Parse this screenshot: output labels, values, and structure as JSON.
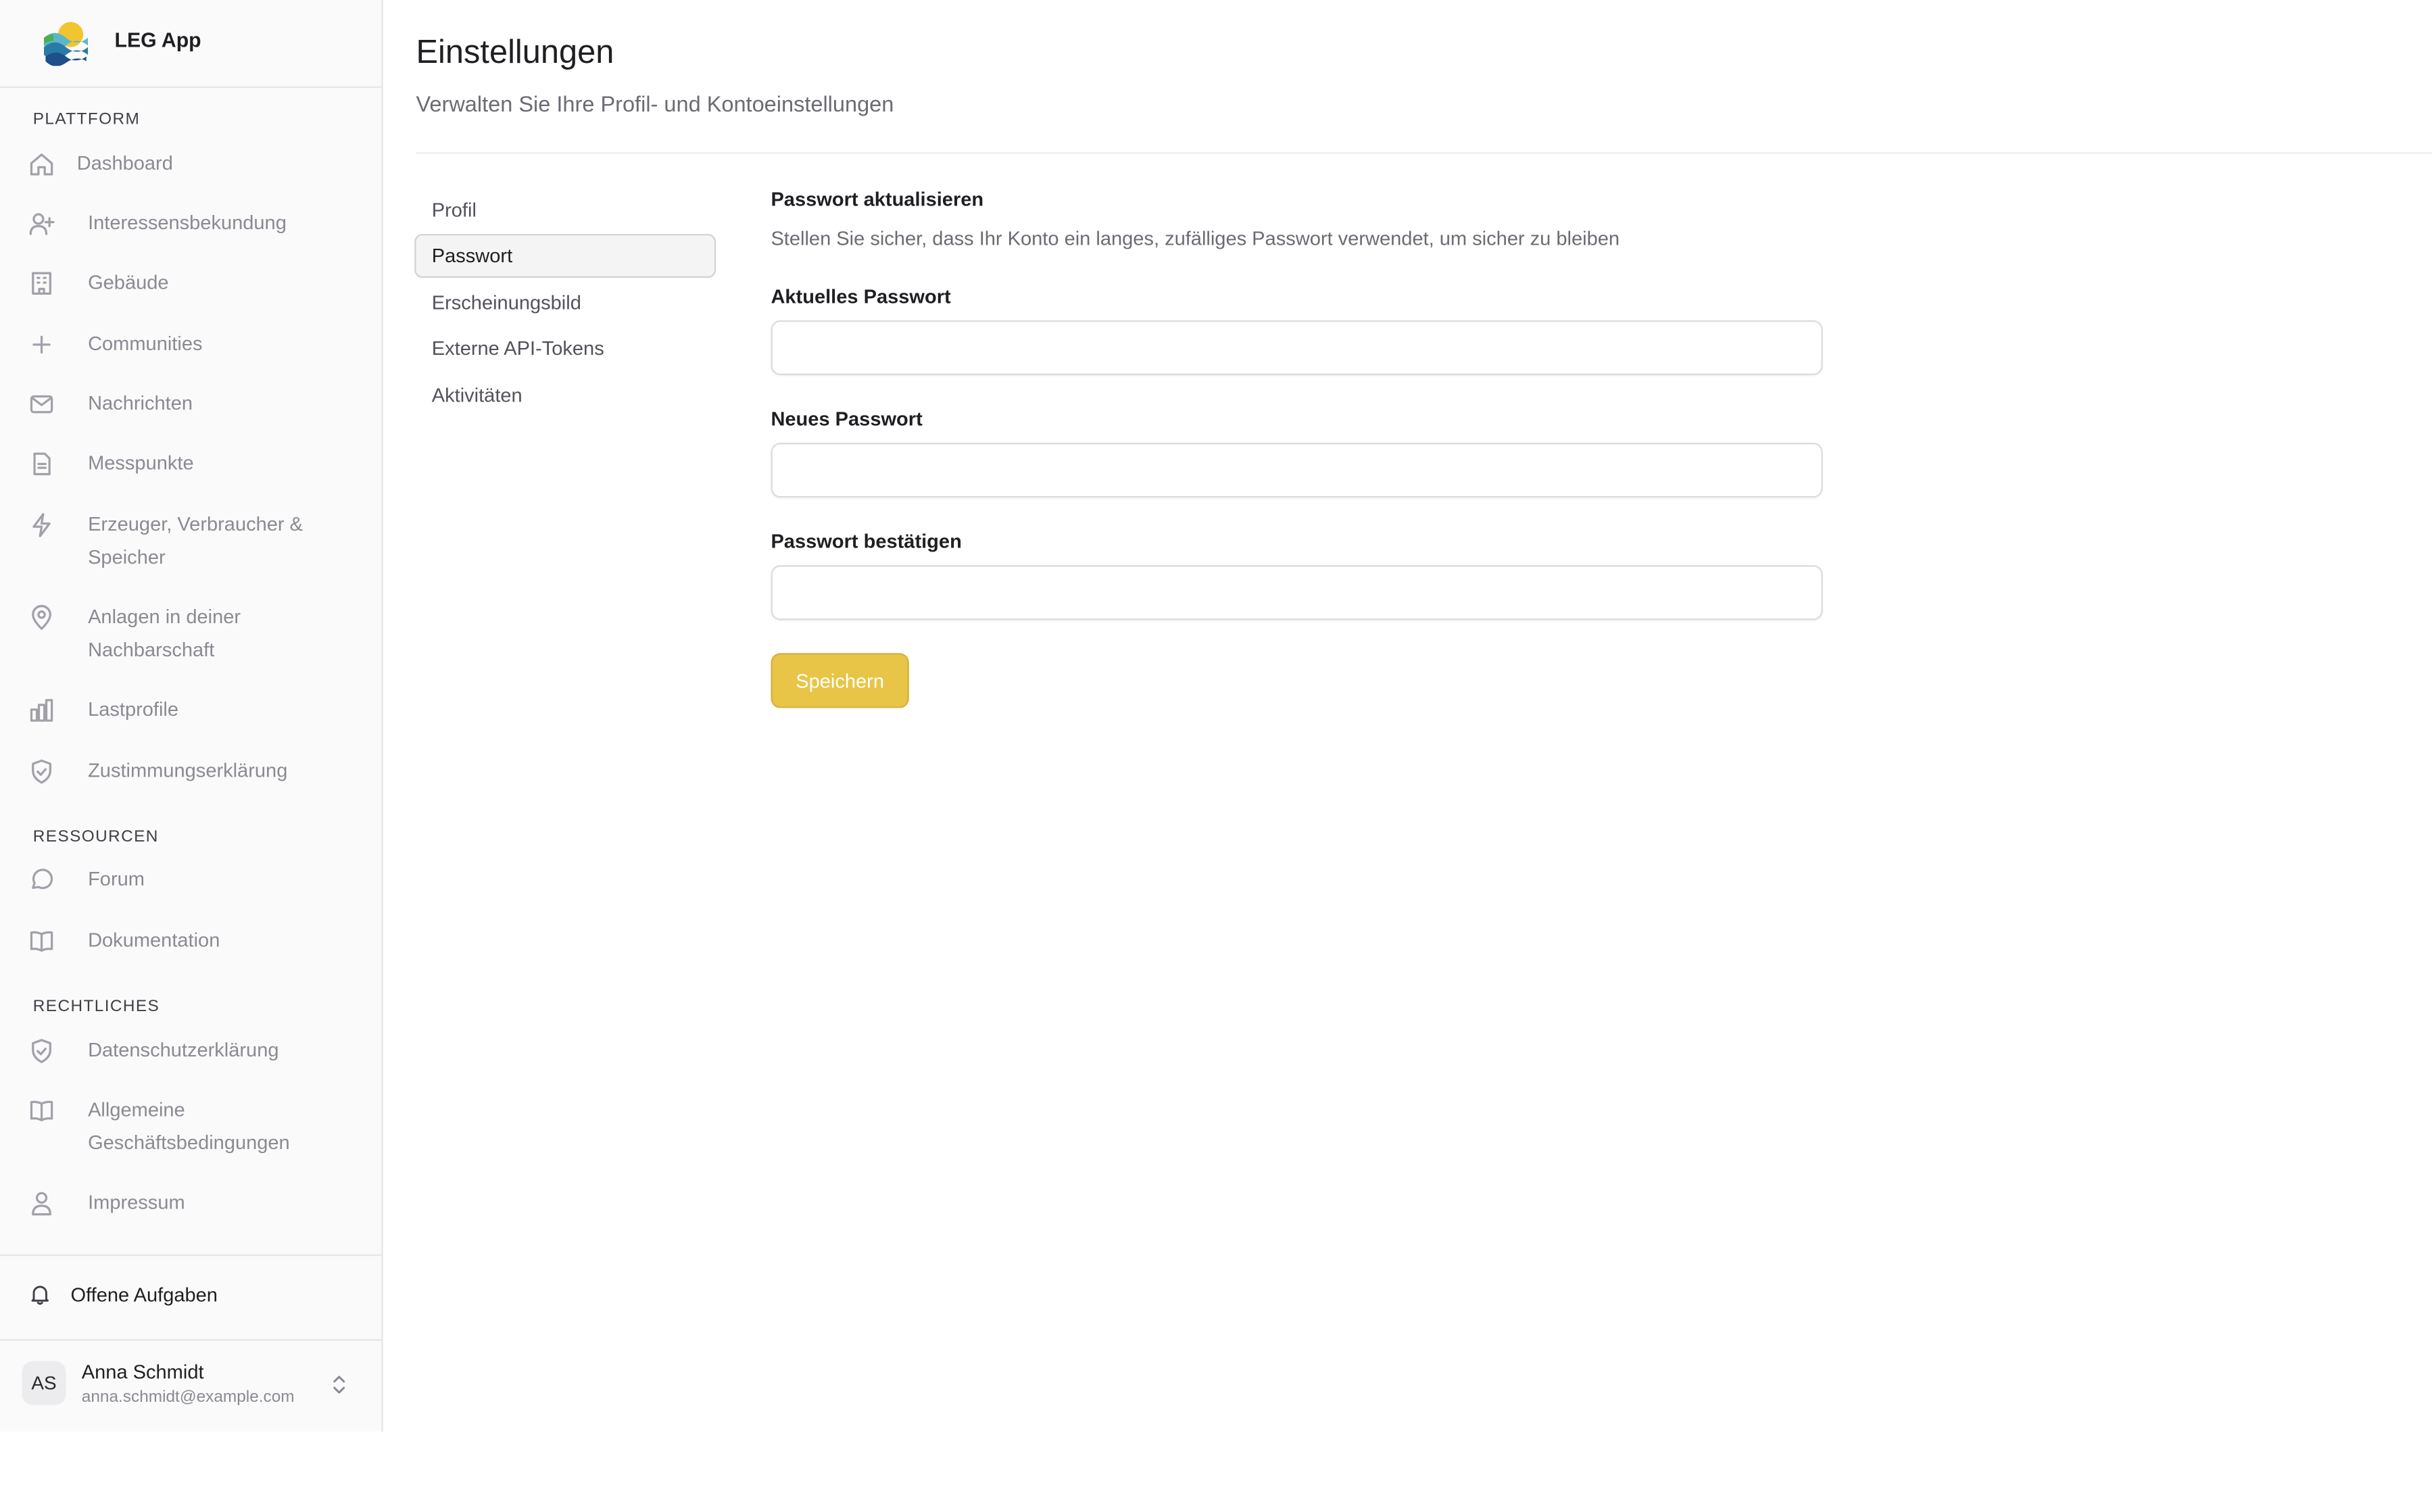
{
  "app": {
    "name": "LEG App"
  },
  "sidebar": {
    "sections": [
      {
        "label": "PLATTFORM"
      },
      {
        "label": "RESSOURCEN"
      },
      {
        "label": "RECHTLICHES"
      }
    ],
    "items": [
      {
        "label": "Dashboard",
        "icon": "home-icon"
      },
      {
        "label": "Interessensbekundung",
        "icon": "user-plus-icon"
      },
      {
        "label": "Gebäude",
        "icon": "building-icon"
      },
      {
        "label": "Communities",
        "icon": "plus-icon"
      },
      {
        "label": "Nachrichten",
        "icon": "mail-icon"
      },
      {
        "label": "Messpunkte",
        "icon": "file-icon"
      },
      {
        "label": "Erzeuger, Verbraucher & Speicher",
        "icon": "bolt-icon"
      },
      {
        "label": "Anlagen in deiner Nachbarschaft",
        "icon": "map-pin-icon"
      },
      {
        "label": "Lastprofile",
        "icon": "bar-chart-icon"
      },
      {
        "label": "Zustimmungserklärung",
        "icon": "shield-check-icon"
      },
      {
        "label": "Forum",
        "icon": "message-circle-icon"
      },
      {
        "label": "Dokumentation",
        "icon": "book-icon"
      },
      {
        "label": "Datenschutzerklärung",
        "icon": "shield-check-icon"
      },
      {
        "label": "Allgemeine Geschäftsbedingungen",
        "icon": "book-icon"
      },
      {
        "label": "Impressum",
        "icon": "user-icon"
      }
    ],
    "tasks": {
      "label": "Offene Aufgaben",
      "icon": "bell-icon"
    },
    "user": {
      "initials": "AS",
      "name": "Anna Schmidt",
      "email": "anna.schmidt@example.com"
    }
  },
  "main": {
    "title": "Einstellungen",
    "subtitle": "Verwalten Sie Ihre Profil- und Kontoeinstellungen",
    "tabs": [
      {
        "label": "Profil"
      },
      {
        "label": "Passwort",
        "active": true
      },
      {
        "label": "Erscheinungsbild"
      },
      {
        "label": "Externe API-Tokens"
      },
      {
        "label": "Aktivitäten"
      }
    ],
    "form": {
      "heading": "Passwort aktualisieren",
      "description": "Stellen Sie sicher, dass Ihr Konto ein langes, zufälliges Passwort verwendet, um sicher zu bleiben",
      "fields": [
        {
          "label": "Aktuelles Passwort",
          "value": ""
        },
        {
          "label": "Neues Passwort",
          "value": ""
        },
        {
          "label": "Passwort bestätigen",
          "value": ""
        }
      ],
      "save_label": "Speichern"
    }
  },
  "colors": {
    "accent": "#e8c547",
    "sidebar_bg": "#fafafa",
    "muted_text": "#8a8a93"
  }
}
